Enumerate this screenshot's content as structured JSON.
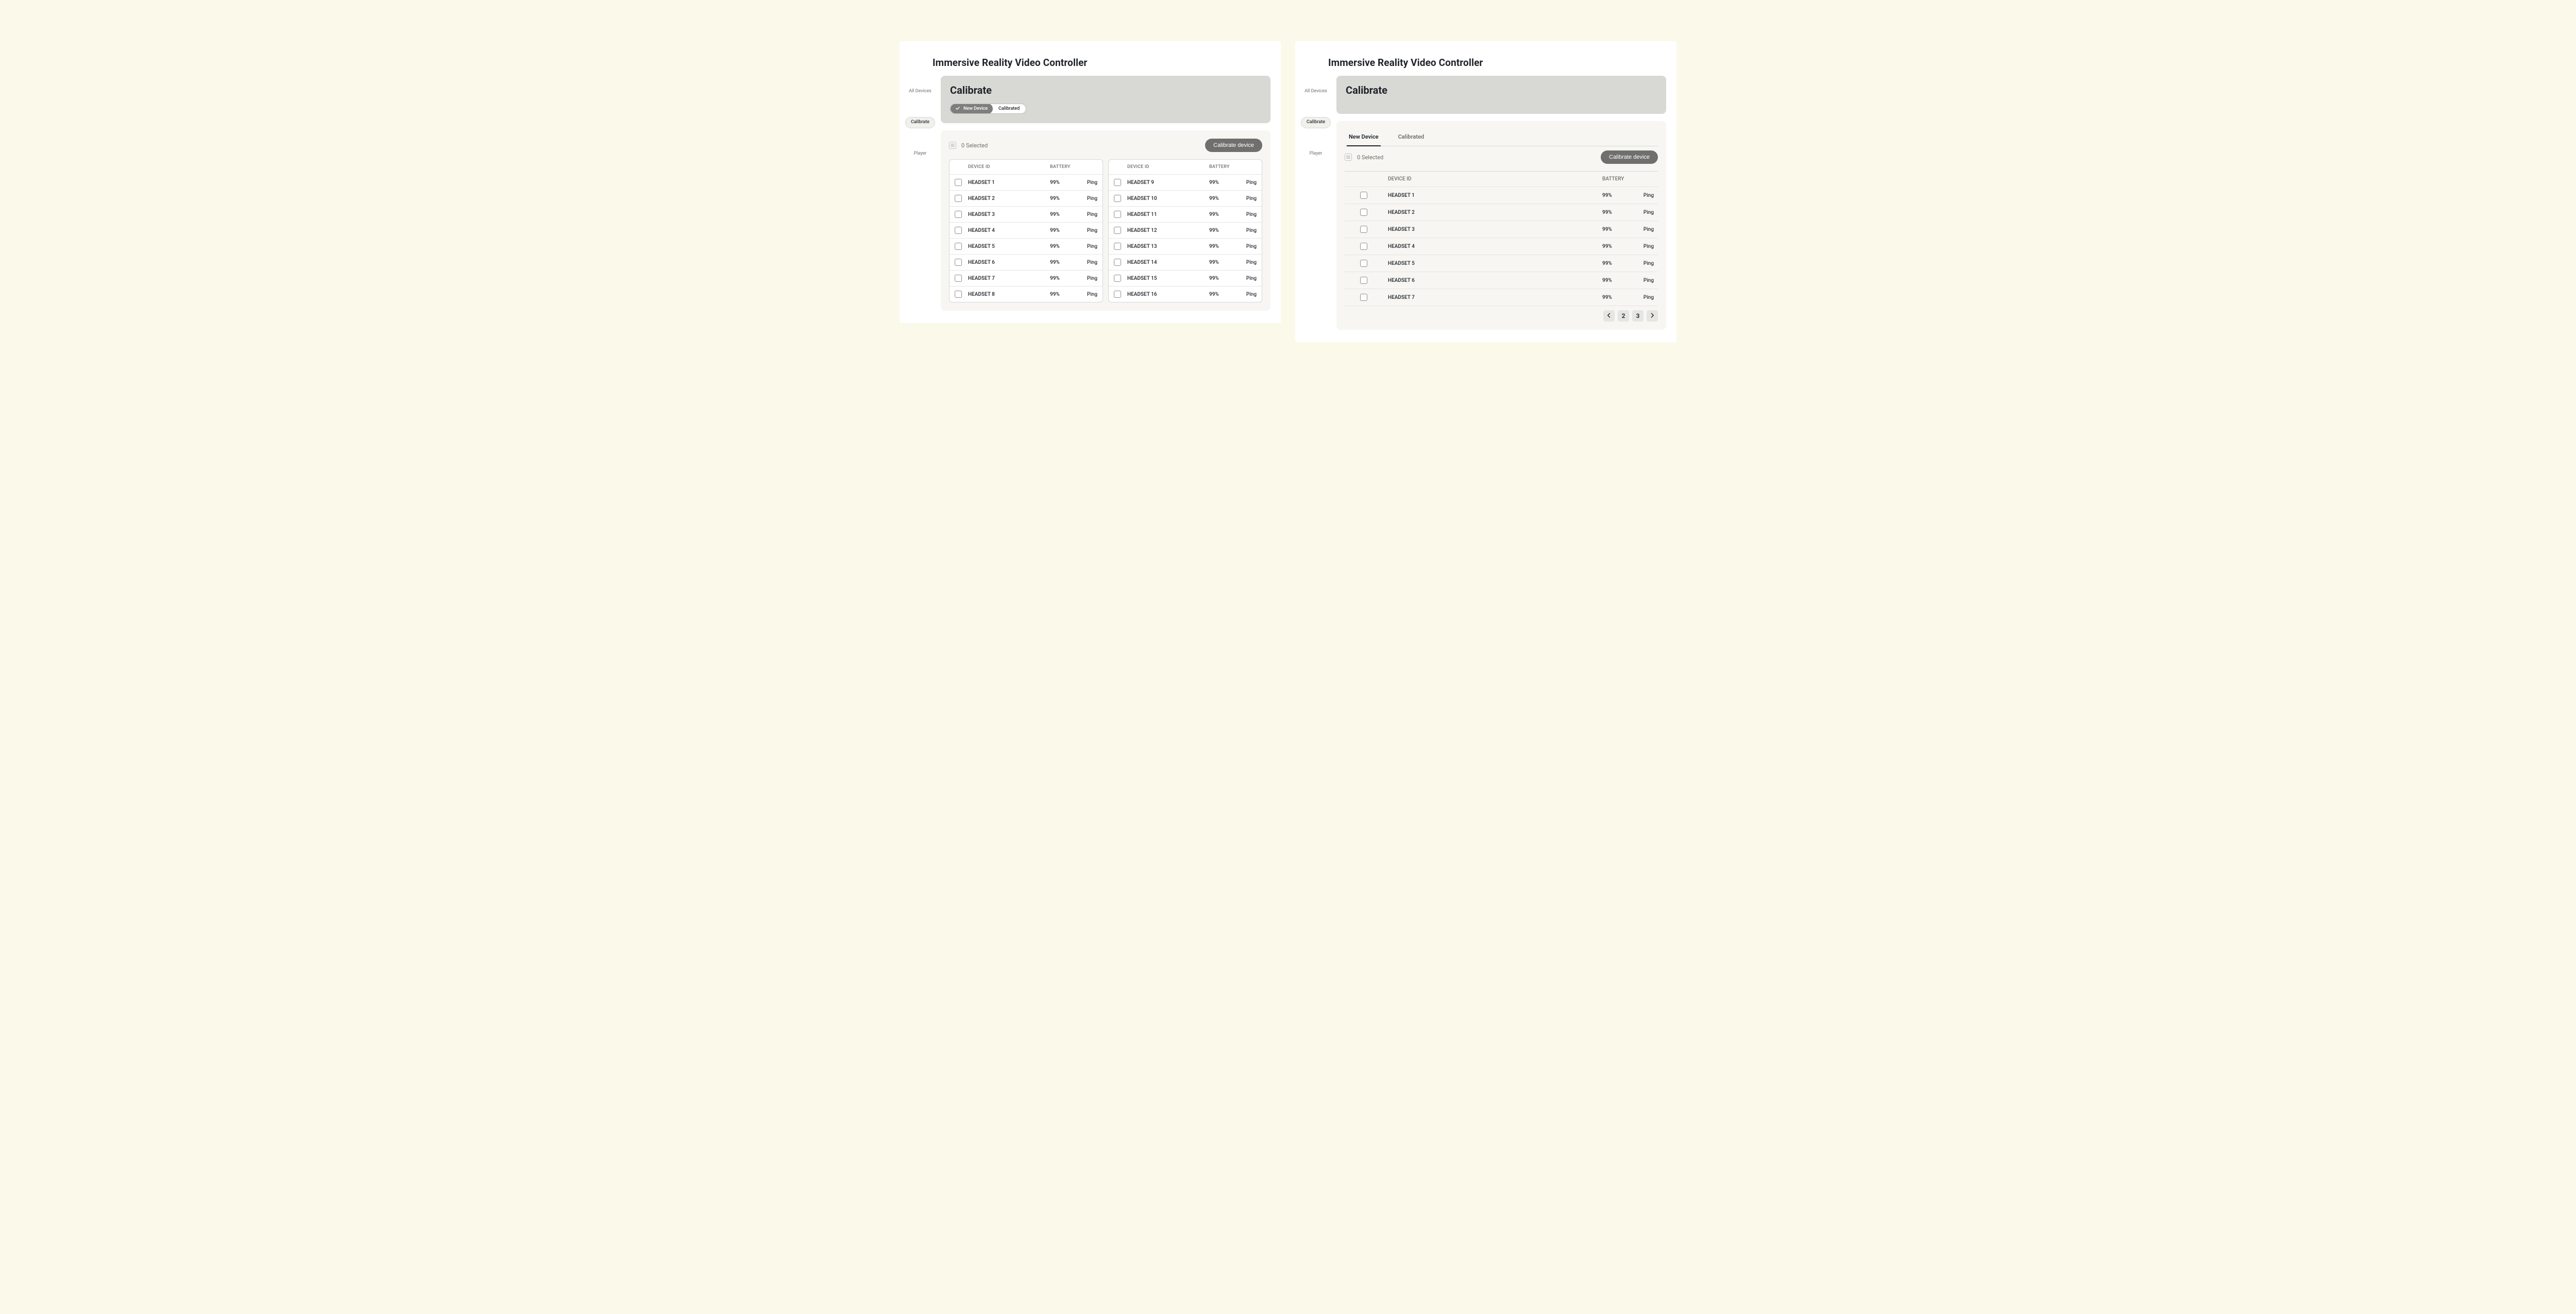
{
  "sidebar": {
    "items": [
      {
        "label": "All Devices"
      },
      {
        "label": "Calibrate"
      },
      {
        "label": "Player"
      }
    ]
  },
  "page_title": "Immersive Reality Video Controller",
  "calibrate": {
    "heading": "Calibrate",
    "seg_new": "New Device",
    "seg_calibrated": "Calibrated",
    "selected_count": "0 Selected",
    "calibrate_button": "Calibrate device",
    "headers": {
      "device_id": "DEVICE ID",
      "battery": "BATTERY"
    },
    "ping_label": "Ping",
    "devices_left": [
      {
        "id": "HEADSET 1",
        "battery": "99%"
      },
      {
        "id": "HEADSET 2",
        "battery": "99%"
      },
      {
        "id": "HEADSET 3",
        "battery": "99%"
      },
      {
        "id": "HEADSET 4",
        "battery": "99%"
      },
      {
        "id": "HEADSET 5",
        "battery": "99%"
      },
      {
        "id": "HEADSET 6",
        "battery": "99%"
      },
      {
        "id": "HEADSET 7",
        "battery": "99%"
      },
      {
        "id": "HEADSET 8",
        "battery": "99%"
      }
    ],
    "devices_right": [
      {
        "id": "HEADSET 9",
        "battery": "99%"
      },
      {
        "id": "HEADSET 10",
        "battery": "99%"
      },
      {
        "id": "HEADSET 11",
        "battery": "99%"
      },
      {
        "id": "HEADSET 12",
        "battery": "99%"
      },
      {
        "id": "HEADSET 13",
        "battery": "99%"
      },
      {
        "id": "HEADSET 14",
        "battery": "99%"
      },
      {
        "id": "HEADSET 15",
        "battery": "99%"
      },
      {
        "id": "HEADSET 16",
        "battery": "99%"
      }
    ]
  },
  "variantB": {
    "tabs": {
      "new": "New Device",
      "calibrated": "Calibrated"
    },
    "devices": [
      {
        "id": "HEADSET 1",
        "battery": "99%"
      },
      {
        "id": "HEADSET 2",
        "battery": "99%"
      },
      {
        "id": "HEADSET 3",
        "battery": "99%"
      },
      {
        "id": "HEADSET 4",
        "battery": "99%"
      },
      {
        "id": "HEADSET 5",
        "battery": "99%"
      },
      {
        "id": "HEADSET 6",
        "battery": "99%"
      },
      {
        "id": "HEADSET 7",
        "battery": "99%"
      }
    ],
    "pager": {
      "pages": [
        "2",
        "3"
      ]
    }
  }
}
